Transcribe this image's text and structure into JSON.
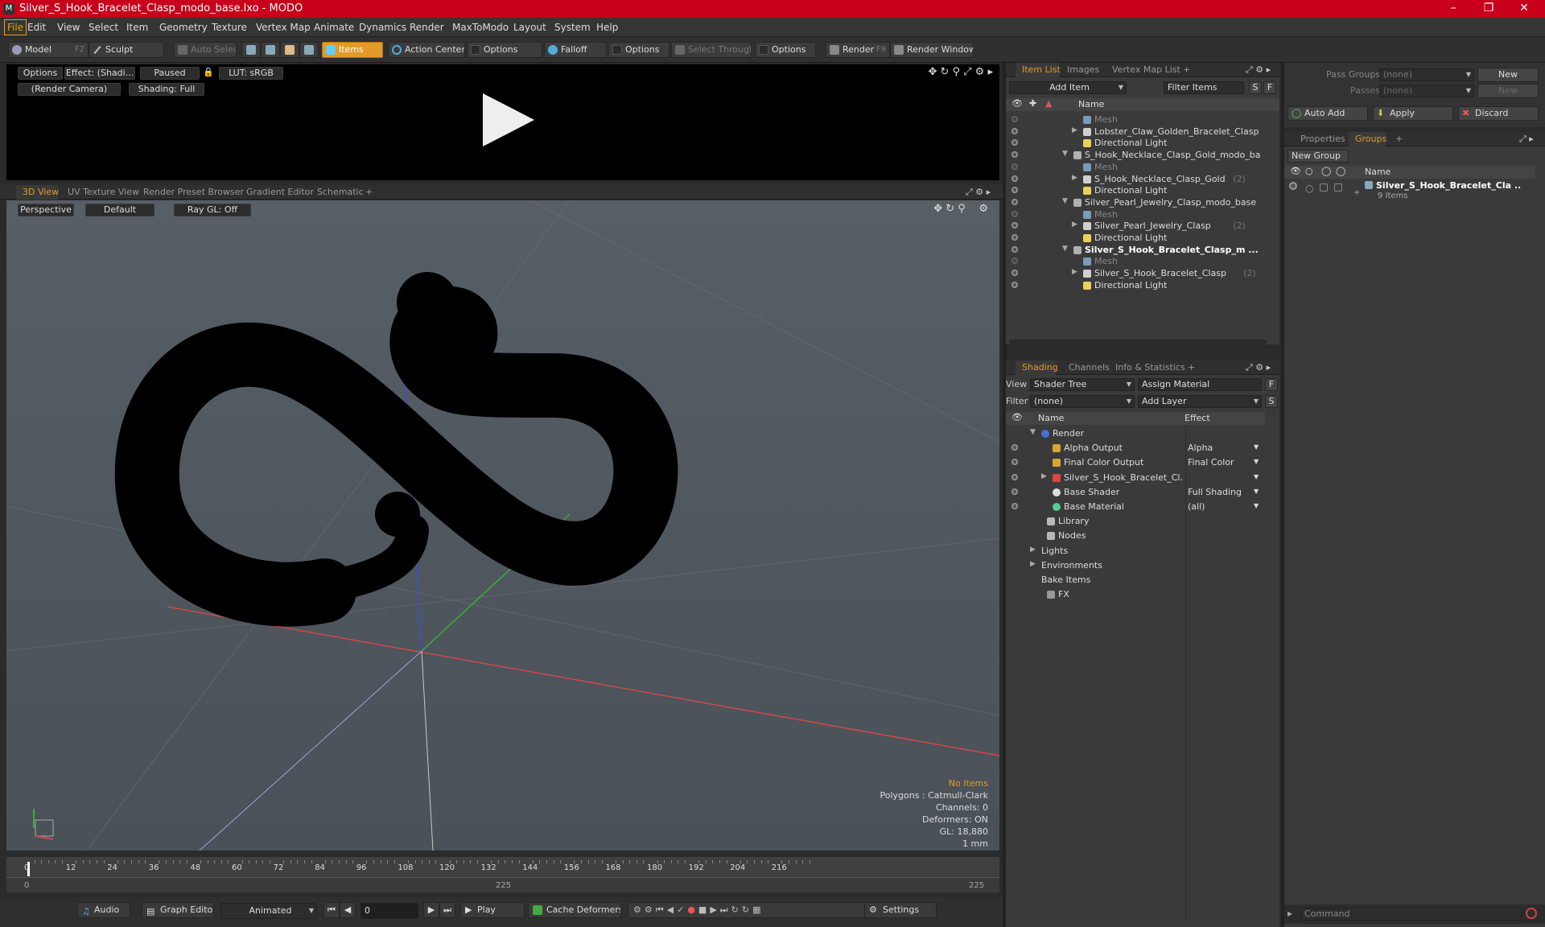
{
  "window": {
    "title": "Silver_S_Hook_Bracelet_Clasp_modo_base.lxo - MODO"
  },
  "menu": [
    "File",
    "Edit",
    "View",
    "Select",
    "Item",
    "Geometry",
    "Texture",
    "Vertex Map",
    "Animate",
    "Dynamics",
    "Render",
    "MaxToModo",
    "Layout",
    "System",
    "Help"
  ],
  "toolbar": {
    "model": "Model",
    "model_key": "F2",
    "sculpt": "Sculpt",
    "auto_select": "Auto Select",
    "items": "Items",
    "action_center": "Action Center",
    "options": "Options",
    "falloff": "Falloff",
    "select_through": "Select Through",
    "render": "Render",
    "render_key": "F9",
    "render_window": "Render Window"
  },
  "preview": {
    "options": "Options",
    "effect": "Effect: (Shadi...",
    "paused": "Paused",
    "lut": "LUT: sRGB",
    "camera": "(Render Camera)",
    "shading": "Shading: Full"
  },
  "viewtabs": [
    "3D View",
    "UV Texture View",
    "Render Preset Browser",
    "Gradient Editor",
    "Schematic"
  ],
  "viewport": {
    "projection": "Perspective",
    "style": "Default",
    "raygl": "Ray GL: Off"
  },
  "stats": {
    "items": "No Items",
    "polygons": "Polygons : Catmull-Clark",
    "channels": "Channels: 0",
    "deformers": "Deformers: ON",
    "gl": "GL: 18,880",
    "unit": "1 mm"
  },
  "timeline": {
    "ticks": [
      "0",
      "12",
      "24",
      "36",
      "48",
      "60",
      "72",
      "84",
      "96",
      "108",
      "120",
      "132",
      "144",
      "156",
      "168",
      "180",
      "192",
      "204",
      "216"
    ],
    "start": "0",
    "mid": "225",
    "end": "225"
  },
  "transport": {
    "audio": "Audio",
    "graph_editor": "Graph Editor",
    "animated": "Animated",
    "frame": "0",
    "play": "Play",
    "cache": "Cache Deformers",
    "settings": "Settings"
  },
  "itemlist": {
    "tabs": [
      "Item List",
      "Images",
      "Vertex Map List"
    ],
    "add_item": "Add Item",
    "filter": "Filter Items",
    "s": "S",
    "f": "F",
    "col_name": "Name",
    "rows": [
      {
        "label": "Mesh",
        "indent": 2,
        "kind": "mesh",
        "dim": true,
        "bold": false,
        "expander": "",
        "count": ""
      },
      {
        "label": "Lobster_Claw_Golden_Bracelet_Clasp ...",
        "indent": 2,
        "kind": "group",
        "dim": false,
        "bold": false,
        "expander": "▶",
        "count": ""
      },
      {
        "label": "Directional Light",
        "indent": 2,
        "kind": "light",
        "dim": false,
        "bold": false,
        "expander": "",
        "count": ""
      },
      {
        "label": "S_Hook_Necklace_Clasp_Gold_modo_ba ...",
        "indent": 1,
        "kind": "scene",
        "dim": false,
        "bold": false,
        "expander": "▼",
        "count": ""
      },
      {
        "label": "Mesh",
        "indent": 2,
        "kind": "mesh",
        "dim": true,
        "bold": false,
        "expander": "",
        "count": ""
      },
      {
        "label": "S_Hook_Necklace_Clasp_Gold",
        "indent": 2,
        "kind": "group",
        "dim": false,
        "bold": false,
        "expander": "▶",
        "count": "(2)"
      },
      {
        "label": "Directional Light",
        "indent": 2,
        "kind": "light",
        "dim": false,
        "bold": false,
        "expander": "",
        "count": ""
      },
      {
        "label": "Silver_Pearl_Jewelry_Clasp_modo_base ...",
        "indent": 1,
        "kind": "scene",
        "dim": false,
        "bold": false,
        "expander": "▼",
        "count": ""
      },
      {
        "label": "Mesh",
        "indent": 2,
        "kind": "mesh",
        "dim": true,
        "bold": false,
        "expander": "",
        "count": ""
      },
      {
        "label": "Silver_Pearl_Jewelry_Clasp",
        "indent": 2,
        "kind": "group",
        "dim": false,
        "bold": false,
        "expander": "▶",
        "count": "(2)"
      },
      {
        "label": "Directional Light",
        "indent": 2,
        "kind": "light",
        "dim": false,
        "bold": false,
        "expander": "",
        "count": ""
      },
      {
        "label": "Silver_S_Hook_Bracelet_Clasp_m ...",
        "indent": 1,
        "kind": "scene",
        "dim": false,
        "bold": true,
        "expander": "▼",
        "count": ""
      },
      {
        "label": "Mesh",
        "indent": 2,
        "kind": "mesh",
        "dim": true,
        "bold": false,
        "expander": "",
        "count": ""
      },
      {
        "label": "Silver_S_Hook_Bracelet_Clasp",
        "indent": 2,
        "kind": "group",
        "dim": false,
        "bold": false,
        "expander": "▶",
        "count": "(2)"
      },
      {
        "label": "Directional Light",
        "indent": 2,
        "kind": "light",
        "dim": false,
        "bold": false,
        "expander": "",
        "count": ""
      }
    ]
  },
  "shading": {
    "tabs": [
      "Shading",
      "Channels",
      "Info & Statistics"
    ],
    "view_label": "View",
    "view": "Shader Tree",
    "assign": "Assign Material",
    "f": "F",
    "filter_label": "Filter",
    "filter": "(none)",
    "add_layer": "Add Layer",
    "s": "S",
    "col_name": "Name",
    "col_effect": "Effect",
    "rows": [
      {
        "label": "Render",
        "effect": "",
        "indent": 0,
        "eye": false,
        "expander": "▼",
        "icon": "render-sphere"
      },
      {
        "label": "Alpha Output",
        "effect": "Alpha",
        "indent": 1,
        "eye": true,
        "expander": "",
        "icon": "output"
      },
      {
        "label": "Final Color Output",
        "effect": "Final Color",
        "indent": 1,
        "eye": true,
        "expander": "",
        "icon": "output"
      },
      {
        "label": "Silver_S_Hook_Bracelet_Cl...",
        "effect": "",
        "indent": 1,
        "eye": true,
        "expander": "▶",
        "icon": "material-group"
      },
      {
        "label": "Base Shader",
        "effect": "Full Shading",
        "indent": 1,
        "eye": true,
        "expander": "",
        "icon": "shader"
      },
      {
        "label": "Base Material",
        "effect": "(all)",
        "indent": 1,
        "eye": true,
        "expander": "",
        "icon": "material"
      },
      {
        "label": "Library",
        "effect": "",
        "indent": 0.5,
        "eye": false,
        "expander": "",
        "icon": "folder"
      },
      {
        "label": "Nodes",
        "effect": "",
        "indent": 0.5,
        "eye": false,
        "expander": "",
        "icon": "folder"
      },
      {
        "label": "Lights",
        "effect": "",
        "indent": 0,
        "eye": false,
        "expander": "▶",
        "icon": ""
      },
      {
        "label": "Environments",
        "effect": "",
        "indent": 0,
        "eye": false,
        "expander": "▶",
        "icon": ""
      },
      {
        "label": "Bake Items",
        "effect": "",
        "indent": 0,
        "eye": false,
        "expander": "",
        "icon": ""
      },
      {
        "label": "FX",
        "effect": "",
        "indent": 0.5,
        "eye": false,
        "expander": "",
        "icon": "fx"
      }
    ],
    "effect_dropdown_rows": [
      1,
      2,
      3,
      4,
      5
    ]
  },
  "passgroups": {
    "label": "Pass Groups",
    "value": "(none)",
    "new": "New"
  },
  "passes": {
    "label": "Passes",
    "value": "(none)",
    "new": "New",
    "auto_add": "Auto Add",
    "apply": "Apply",
    "discard": "Discard"
  },
  "groups": {
    "tabs": [
      "Properties",
      "Groups"
    ],
    "new_group": "New Group",
    "col_name": "Name",
    "row": {
      "name": "Silver_S_Hook_Bracelet_Cla ...",
      "count": "9 Items"
    }
  },
  "command": {
    "placeholder": "Command"
  },
  "colors": {
    "accent": "#e39a28",
    "titlebar": "#c8001b",
    "panel": "#3a3a3a"
  },
  "icons": [
    "play-icon",
    "lock-icon",
    "gear-icon",
    "eye-icon",
    "chevron-down-icon",
    "record-icon",
    "speaker-icon"
  ]
}
